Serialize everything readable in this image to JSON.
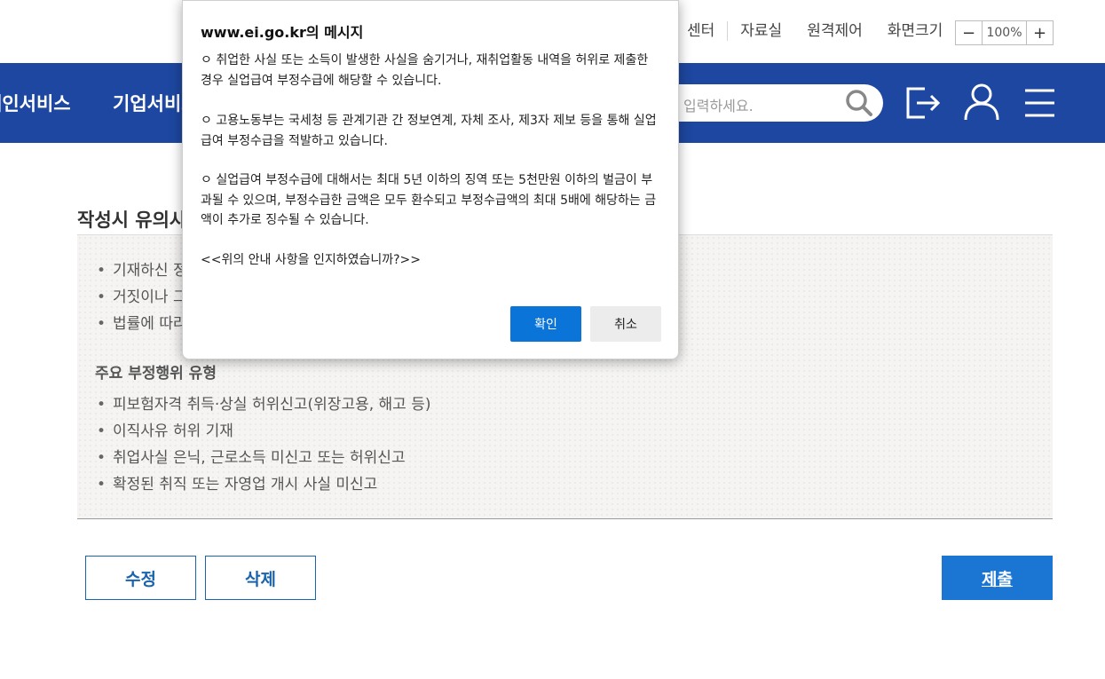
{
  "utility": {
    "links": [
      "센터",
      "자료실",
      "원격제어",
      "화면크기"
    ],
    "zoom": {
      "minus": "−",
      "value": "100%",
      "plus": "+"
    }
  },
  "nav": {
    "menu1": "개인서비스",
    "menu2": "기업서비스",
    "search_placeholder": "입력하세요."
  },
  "content": {
    "section_title": "작성시 유의사항",
    "list1": [
      "기재하신 정",
      "거짓이나 그",
      "법률에 따라"
    ],
    "subheading": "주요 부정행위 유형",
    "list2": [
      "피보험자격 취득·상실 허위신고(위장고용, 해고 등)",
      "이직사유 허위 기재",
      "취업사실 은닉, 근로소득 미신고 또는 허위신고",
      "확정된 취직 또는 자영업 개시 사실 미신고"
    ],
    "buttons": {
      "edit": "수정",
      "delete": "삭제",
      "submit": "제출"
    }
  },
  "dialog": {
    "title": "www.ei.go.kr의 메시지",
    "p1": "ㅇ 취업한 사실 또는 소득이 발생한 사실을 숨기거나, 재취업활동 내역을 허위로 제출한 경우 실업급여 부정수급에 해당할 수 있습니다.",
    "p2": "ㅇ 고용노동부는 국세청 등 관계기관 간 정보연계, 자체 조사, 제3자 제보 등을 통해 실업급여 부정수급을 적발하고 있습니다.",
    "p3": "ㅇ 실업급여 부정수급에 대해서는 최대 5년 이하의 징역 또는 5천만원 이하의 벌금이 부과될 수 있으며, 부정수급한 금액은 모두 환수되고 부정수급액의 최대 5배에 해당하는 금액이 추가로 징수될 수 있습니다.",
    "p4": "<<위의 안내 사항을 인지하였습니까?>>",
    "ok": "확인",
    "cancel": "취소"
  },
  "colors": {
    "nav_bg": "#1d47a0",
    "primary_button": "#1a76d2",
    "dialog_ok": "#0b74d8"
  }
}
